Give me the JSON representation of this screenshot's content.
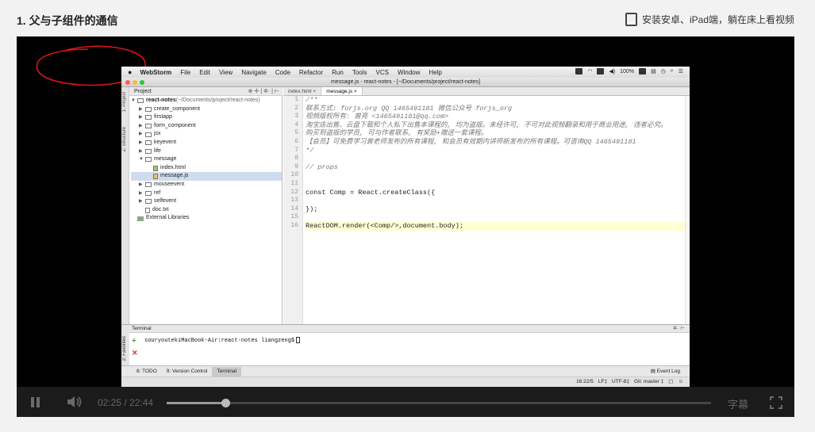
{
  "header": {
    "lesson_title": "1. 父与子组件的通信",
    "install_link": "安装安卓、iPad端，躺在床上看视频"
  },
  "mac_menubar": {
    "app_name": "WebStorm",
    "menus": [
      "File",
      "Edit",
      "View",
      "Navigate",
      "Code",
      "Refactor",
      "Run",
      "Tools",
      "VCS",
      "Window",
      "Help"
    ],
    "battery": "100%"
  },
  "window": {
    "title": "message.js - react-notes - [~/Documents/project/react-notes]"
  },
  "project_panel": {
    "header": "Project",
    "strip_labels": [
      "1: Project",
      "Z: Structure"
    ],
    "tree": [
      {
        "arrow": "▼",
        "kind": "folder",
        "label": "react-notes",
        "extra": " (~/Documents/project/react-notes)",
        "bold": true,
        "indent": 0
      },
      {
        "arrow": "▶",
        "kind": "folder",
        "label": "create_component",
        "indent": 1
      },
      {
        "arrow": "▶",
        "kind": "folder",
        "label": "firstapp",
        "indent": 1
      },
      {
        "arrow": "▶",
        "kind": "folder",
        "label": "form_component",
        "indent": 1
      },
      {
        "arrow": "▶",
        "kind": "folder",
        "label": "jsx",
        "indent": 1
      },
      {
        "arrow": "▶",
        "kind": "folder",
        "label": "keyevent",
        "indent": 1
      },
      {
        "arrow": "▶",
        "kind": "folder",
        "label": "life",
        "indent": 1
      },
      {
        "arrow": "▼",
        "kind": "folder",
        "label": "message",
        "indent": 1
      },
      {
        "arrow": "",
        "kind": "html",
        "label": "index.html",
        "indent": 2
      },
      {
        "arrow": "",
        "kind": "js",
        "label": "message.js",
        "indent": 2,
        "selected": true
      },
      {
        "arrow": "▶",
        "kind": "folder",
        "label": "mouseevent",
        "indent": 1
      },
      {
        "arrow": "▶",
        "kind": "folder",
        "label": "ref",
        "indent": 1
      },
      {
        "arrow": "▶",
        "kind": "folder",
        "label": "selfevent",
        "indent": 1
      },
      {
        "arrow": "",
        "kind": "file",
        "label": "doc.txt",
        "indent": 1
      },
      {
        "arrow": "",
        "kind": "libs",
        "label": "External Libraries",
        "indent": 0
      }
    ]
  },
  "editor": {
    "tabs": [
      {
        "label": "index.html ×",
        "active": false
      },
      {
        "label": "message.js ×",
        "active": true
      }
    ],
    "lines": [
      "/**",
      " 联系方式: forjs.org  QQ 1465491181  微信公众号 forjs_org",
      " 视频版权所有: 曾亮 <1465491181@qq.com>",
      " 淘宝店出售、云盘下载和个人私下出售本课程的, 均为盗版。未经许可, 不可对此视频翻录和用于商业用途, 违者必究。",
      " 购买到盗版的学员, 可与作者联系, 有奖励+赠送一套课程。",
      " 【会员】可免费学习曾老师发布的所有课程, 和会员有效期内讲师新发布的所有课程。可咨询QQ 1465491181",
      " */",
      "",
      "// props",
      "",
      "",
      "const Comp = React.createClass({",
      "",
      "});",
      "",
      "ReactDOM.render(<Comp/>,document.body);"
    ],
    "line_numbers": [
      "1",
      "2",
      "3",
      "4",
      "5",
      "6",
      "7",
      "8",
      "9",
      "10",
      "11",
      "12",
      "13",
      "14",
      "15",
      "16"
    ]
  },
  "terminal": {
    "title": "Terminal",
    "strip_label": "2: Favorites",
    "prompt": "souryoutekiMacBook-Air:react-notes liangzeng$"
  },
  "tool_tabs": {
    "tabs": [
      {
        "label": "6: TODO",
        "active": false
      },
      {
        "label": "9: Version Control",
        "active": false
      },
      {
        "label": "Terminal",
        "active": true
      }
    ],
    "event_log": "Event Log"
  },
  "status_bar": {
    "position": "16:22/5",
    "line_sep": "LF‡",
    "encoding": "UTF-8‡",
    "git": "Git: master ‡"
  },
  "player": {
    "current_time": "02:25",
    "separator": "/",
    "duration": "22:44",
    "progress_fraction": 0.108,
    "subtitle_label": "字幕"
  }
}
